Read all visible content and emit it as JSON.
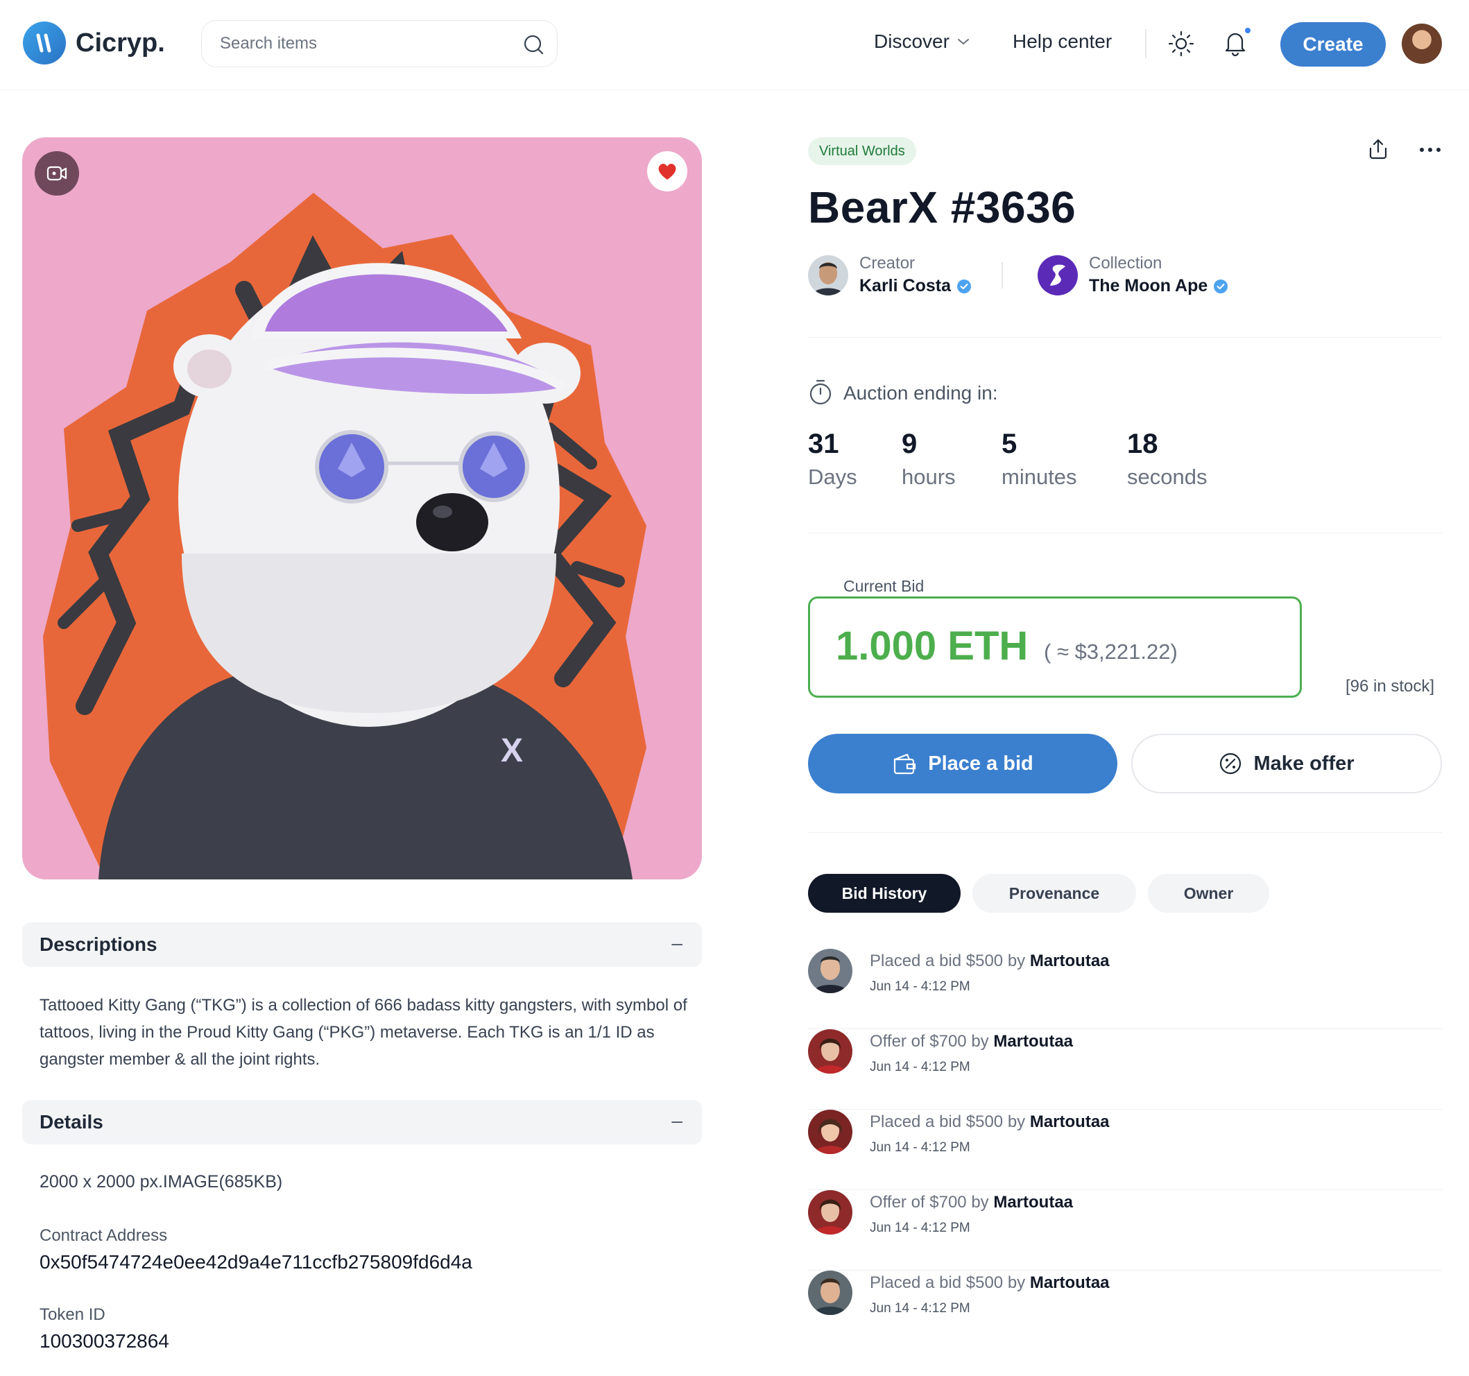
{
  "header": {
    "brand": "Cicryp.",
    "search_placeholder": "Search items",
    "nav_discover": "Discover",
    "nav_help": "Help center",
    "create_label": "Create"
  },
  "item": {
    "category_tag": "Virtual Worlds",
    "title": "BearX #3636",
    "creator_role": "Creator",
    "creator_name": "Karli Costa",
    "collection_role": "Collection",
    "collection_name": "The Moon Ape"
  },
  "auction": {
    "label": "Auction ending in:",
    "days": "31",
    "days_unit": "Days",
    "hours": "9",
    "hours_unit": "hours",
    "minutes": "5",
    "minutes_unit": "minutes",
    "seconds": "18",
    "seconds_unit": "seconds"
  },
  "bid": {
    "label": "Current Bid",
    "eth": "1.000 ETH",
    "usd": "( ≈ $3,221.22)",
    "stock": "[96 in stock]",
    "place_bid": "Place a bid",
    "make_offer": "Make offer"
  },
  "tabs": [
    "Bid History",
    "Provenance",
    "Owner"
  ],
  "history": [
    {
      "action": "Placed a bid $500 by",
      "user": "Martoutaa",
      "time": "Jun 14 - 4:12 PM"
    },
    {
      "action": "Offer of $700 by",
      "user": "Martoutaa",
      "time": "Jun 14 - 4:12 PM"
    },
    {
      "action": "Placed a bid $500 by",
      "user": "Martoutaa",
      "time": "Jun 14 - 4:12 PM"
    },
    {
      "action": "Offer of $700 by",
      "user": "Martoutaa",
      "time": "Jun 14 - 4:12 PM"
    },
    {
      "action": "Placed a bid $500 by",
      "user": "Martoutaa",
      "time": "Jun 14 - 4:12 PM"
    }
  ],
  "descriptions": {
    "heading": "Descriptions",
    "toggle": "–",
    "text": "Tattooed Kitty Gang (“TKG”) is a collection of 666 badass kitty gangsters, with symbol of tattoos, living in the Proud Kitty Gang (“PKG”) metaverse. Each TKG is an 1/1 ID as gangster member & all the joint rights."
  },
  "details": {
    "heading": "Details",
    "toggle": "–",
    "size": "2000 x 2000 px.IMAGE(685KB)",
    "contract_label": "Contract Address",
    "contract_value": "0x50f5474724e0ee42d9a4e711ccfb275809fd6d4a",
    "token_label": "Token ID",
    "token_value": "100300372864"
  },
  "colors": {
    "accent": "#3b7fcf",
    "bid_green": "#4cae4c",
    "artwork_bg": "#eda8ca"
  }
}
